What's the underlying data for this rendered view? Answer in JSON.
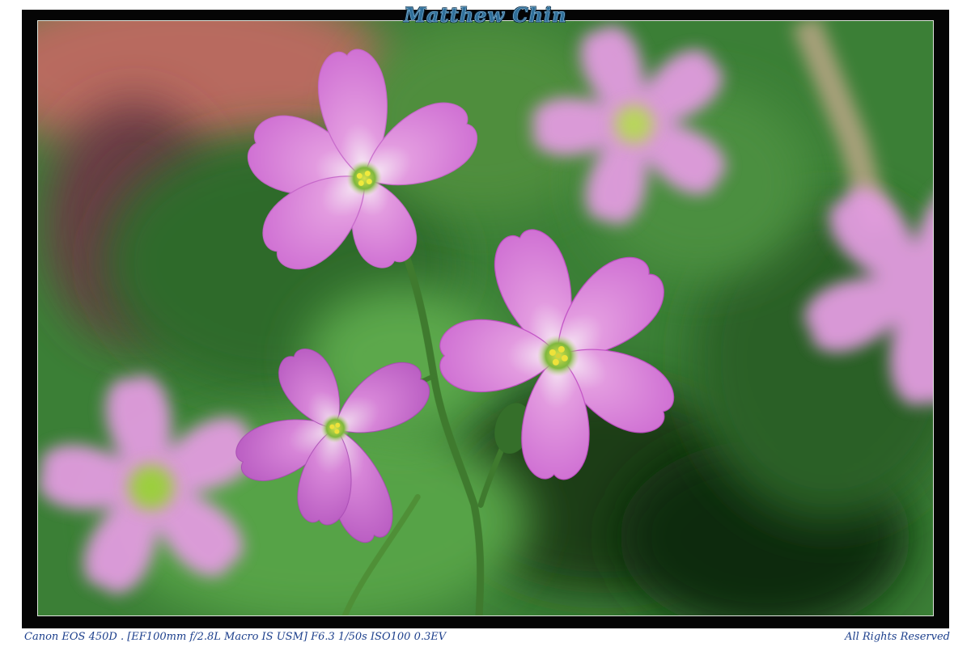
{
  "watermark": "Matthew Chin",
  "caption": {
    "exif": "Canon EOS 450D . [EF100mm f/2.8L Macro IS USM] F6.3 1/50s ISO100 0.3EV",
    "rights": "All Rights Reserved"
  },
  "colors": {
    "frame": "#050505",
    "background_green": "#3f8a3c",
    "petal_pink": "#d77ad6",
    "center_yellow": "#e6e04a",
    "caption_blue": "#1c3f8c"
  }
}
